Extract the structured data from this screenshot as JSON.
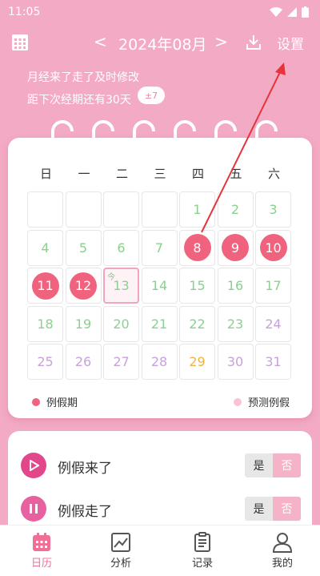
{
  "status": {
    "time": "11:05"
  },
  "header": {
    "prev": "<",
    "month_title": "2024年08月",
    "next": ">",
    "settings_label": "设置"
  },
  "messages": {
    "line1": "月经来了走了及时修改",
    "line2": "距下次经期还有30天",
    "bubble": "±7"
  },
  "calendar": {
    "weekdays": [
      "日",
      "一",
      "二",
      "三",
      "四",
      "五",
      "六"
    ],
    "today_tag": "今",
    "days": [
      "",
      "",
      "",
      "",
      "1",
      "2",
      "3",
      "4",
      "5",
      "6",
      "7",
      "8",
      "9",
      "10",
      "11",
      "12",
      "13",
      "14",
      "15",
      "16",
      "17",
      "18",
      "19",
      "20",
      "21",
      "22",
      "23",
      "24",
      "25",
      "26",
      "27",
      "28",
      "29",
      "30",
      "31"
    ],
    "period_days": [
      "8",
      "9",
      "10",
      "11",
      "12"
    ],
    "today": "13",
    "predicted_days": [
      "24",
      "25",
      "26",
      "27",
      "28",
      "30",
      "31"
    ],
    "highlight_day": "29",
    "legend": {
      "period": "例假期",
      "predicted": "预测例假"
    }
  },
  "panel": {
    "rows": [
      {
        "label": "例假来了",
        "yes": "是",
        "no": "否"
      },
      {
        "label": "例假走了",
        "yes": "是",
        "no": "否"
      }
    ]
  },
  "nav": {
    "items": [
      {
        "label": "日历"
      },
      {
        "label": "分析"
      },
      {
        "label": "记录"
      },
      {
        "label": "我的"
      }
    ]
  },
  "colors": {
    "background": "#f3aac4",
    "period": "#f0637f",
    "normal_day": "#8bd08f",
    "predicted_day": "#c8a1db",
    "highlight_day": "#f0b244",
    "accent": "#ef6f96"
  }
}
